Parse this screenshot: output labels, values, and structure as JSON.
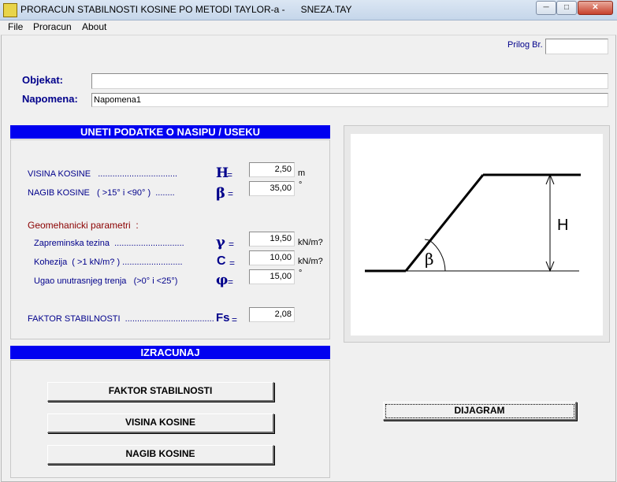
{
  "window": {
    "title": "PRORACUN STABILNOSTI KOSINE PO METODI TAYLOR-a -      SNEZA.TAY",
    "min": "─",
    "max": "□",
    "close": "✕"
  },
  "menu": [
    "File",
    "Proracun",
    "About"
  ],
  "prilog": {
    "label": "Prilog Br.",
    "value": ""
  },
  "objekat": {
    "label": "Objekat:",
    "value": ""
  },
  "napomena": {
    "label": "Napomena:",
    "value": "Napomena1"
  },
  "input_header": "UNETI  PODATKE O NASIPU / USEKU",
  "params": {
    "visina": {
      "label": "VISINA KOSINE   .................................",
      "symbol": "H",
      "eq": "=",
      "value": "2,50",
      "unit": "m"
    },
    "nagib": {
      "label": "NAGIB KOSINE   ( >15° i <90° )  ........",
      "symbol": "β",
      "eq": "=",
      "value": "35,00",
      "unit": "°"
    },
    "geo_title": "Geomehanicki parametri  :",
    "tezina": {
      "label": "Zapreminska tezina  .............................",
      "symbol": "γ",
      "eq": "=",
      "value": "19,50",
      "unit": "kN/m?"
    },
    "kohezija": {
      "label": "Kohezija  ( >1 kN/m? ) .........................",
      "symbol": "C",
      "eq": "=",
      "value": "10,00",
      "unit": "kN/m?"
    },
    "trenje": {
      "label": "Ugao unutrasnjeg trenja   (>0° i <25°)",
      "symbol": "φ",
      "eq": "=",
      "value": "15,00",
      "unit": "°"
    },
    "faktor": {
      "label": "FAKTOR STABILNOSTI  .....................................",
      "symbol": "Fs",
      "eq": "=",
      "value": "2,08"
    }
  },
  "calc_header": "IZRACUNAJ",
  "buttons": {
    "faktor": "FAKTOR STABILNOSTI",
    "visina": "VISINA KOSINE",
    "nagib": "NAGIB KOSINE",
    "dijagram": "DIJAGRAM"
  },
  "diagram": {
    "h_label": "H",
    "angle_label": "β"
  }
}
